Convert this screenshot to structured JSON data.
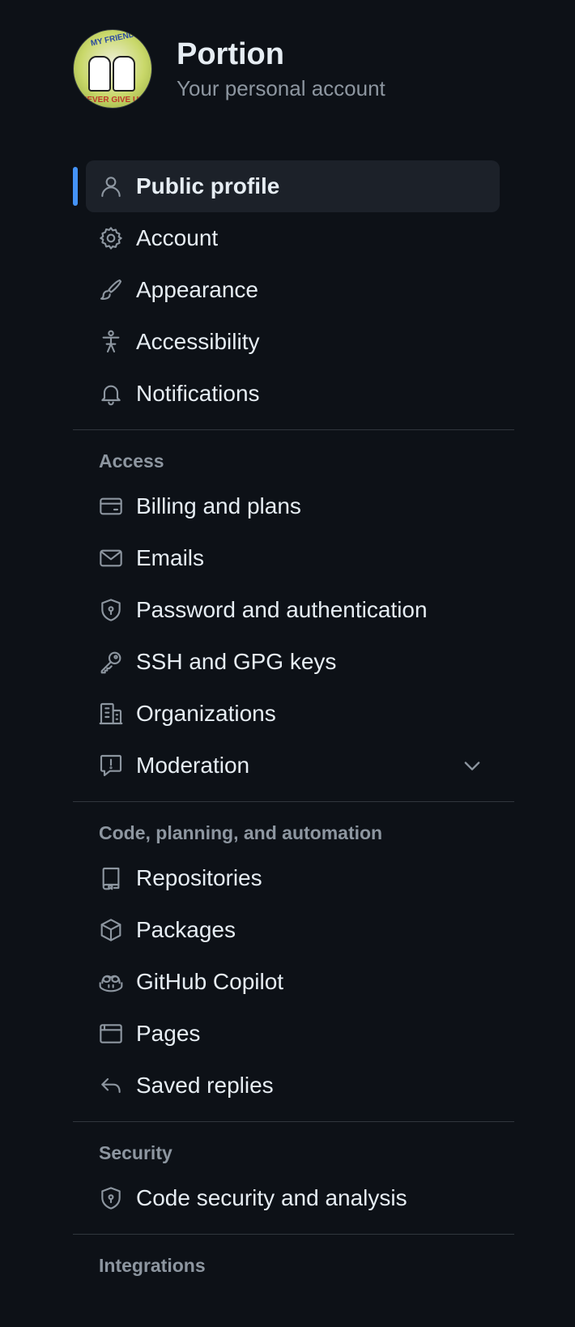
{
  "account": {
    "name": "Portion",
    "subtitle": "Your personal account",
    "avatar_text_top": "MY FRIEND",
    "avatar_text_bottom": "NEVER GIVE UP"
  },
  "nav": {
    "main": [
      {
        "label": "Public profile",
        "icon": "person-icon",
        "active": true
      },
      {
        "label": "Account",
        "icon": "gear-icon"
      },
      {
        "label": "Appearance",
        "icon": "paintbrush-icon"
      },
      {
        "label": "Accessibility",
        "icon": "accessibility-icon"
      },
      {
        "label": "Notifications",
        "icon": "bell-icon"
      }
    ],
    "access": {
      "heading": "Access",
      "items": [
        {
          "label": "Billing and plans",
          "icon": "credit-card-icon"
        },
        {
          "label": "Emails",
          "icon": "mail-icon"
        },
        {
          "label": "Password and authentication",
          "icon": "shield-lock-icon"
        },
        {
          "label": "SSH and GPG keys",
          "icon": "key-icon"
        },
        {
          "label": "Organizations",
          "icon": "organization-icon"
        },
        {
          "label": "Moderation",
          "icon": "report-icon",
          "expandable": true
        }
      ]
    },
    "code": {
      "heading": "Code, planning, and automation",
      "items": [
        {
          "label": "Repositories",
          "icon": "repo-icon"
        },
        {
          "label": "Packages",
          "icon": "package-icon"
        },
        {
          "label": "GitHub Copilot",
          "icon": "copilot-icon"
        },
        {
          "label": "Pages",
          "icon": "browser-icon"
        },
        {
          "label": "Saved replies",
          "icon": "reply-icon"
        }
      ]
    },
    "security": {
      "heading": "Security",
      "items": [
        {
          "label": "Code security and analysis",
          "icon": "shield-lock-icon"
        }
      ]
    },
    "integrations": {
      "heading": "Integrations"
    }
  },
  "colors": {
    "background": "#0d1117",
    "active_bg": "#1c2129",
    "accent": "#4493f8",
    "muted": "#8d96a0",
    "text": "#e6edf3",
    "divider": "#30363d"
  }
}
